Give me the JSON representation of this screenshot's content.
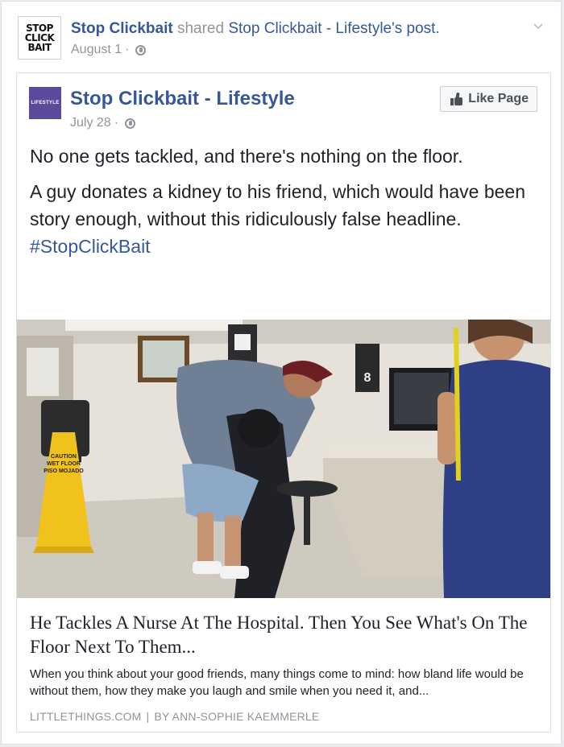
{
  "shared_header": {
    "avatar_lines": [
      "STOP",
      "CLICK",
      "BAIT"
    ],
    "actor": "Stop Clickbait",
    "verb": "shared",
    "target": "Stop Clickbait - Lifestyle's post.",
    "date": "August 1",
    "separator": "·"
  },
  "post": {
    "avatar_text": "LIFESTYLE",
    "page_name": "Stop Clickbait - Lifestyle",
    "date": "July 28",
    "separator": "·",
    "like_button": "Like Page",
    "paragraph1": "No one gets tackled, and there's nothing on the floor.",
    "paragraph2": "A guy donates a kidney to his friend, which would have been story enough, without this ridiculously false headline.",
    "hashtag": "#StopClickBait"
  },
  "link_preview": {
    "title": "He Tackles A Nurse At The Hospital. Then You See What's On The Floor Next To Them...",
    "description": "When you think about your good friends, many things come to mind: how bland life would be without them, how they make you laugh and smile when you need it, and...",
    "source": "LITTLETHINGS.COM",
    "source_sep": "|",
    "author": "BY ANN-SOPHIE KAEMMERLE",
    "image": {
      "sign_lines": [
        "CAUTION",
        "WET FLOOR",
        "PISO MOJADO"
      ],
      "door_number": "8"
    }
  },
  "colors": {
    "link": "#365899",
    "muted": "#90949c",
    "text": "#1d2129",
    "border": "#dddfe2",
    "lifestyle_avatar": "#5b4a9c"
  },
  "icons": [
    "globe-icon",
    "chevron-down-icon",
    "thumbs-up-icon"
  ]
}
